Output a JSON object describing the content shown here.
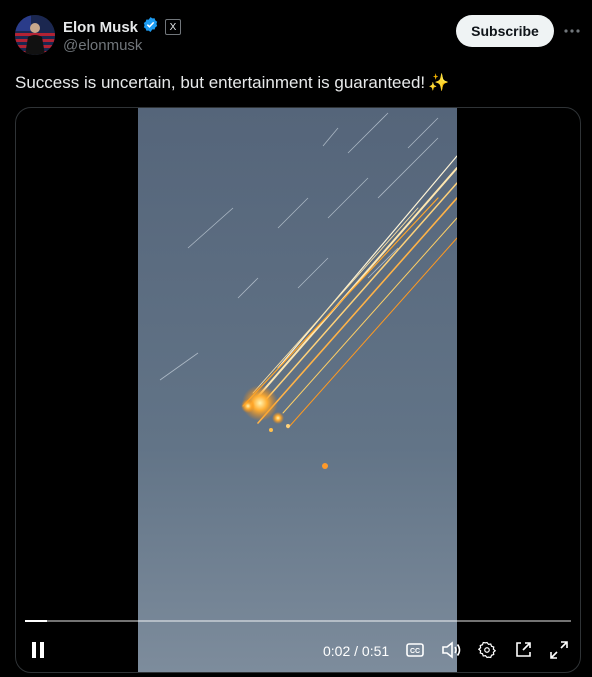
{
  "author": {
    "display_name": "Elon Musk",
    "handle": "@elonmusk",
    "verified": true,
    "avatar_icon": "avatar-photo",
    "affiliate_badge": "X"
  },
  "actions": {
    "subscribe_label": "Subscribe",
    "more_icon": "ellipsis-icon"
  },
  "tweet": {
    "text": "Success is uncertain, but entertainment is guaranteed!",
    "emoji": "✨"
  },
  "video": {
    "current_time": "0:02",
    "separator": "/",
    "duration": "0:51",
    "progress_fraction": 0.04,
    "state": "playing"
  },
  "colors": {
    "background": "#000000",
    "text": "#e7e9ea",
    "secondary": "#71767b",
    "verified_blue": "#1d9bf0",
    "subscribe_bg": "#eff3f4",
    "sky": "#5d6e80"
  }
}
